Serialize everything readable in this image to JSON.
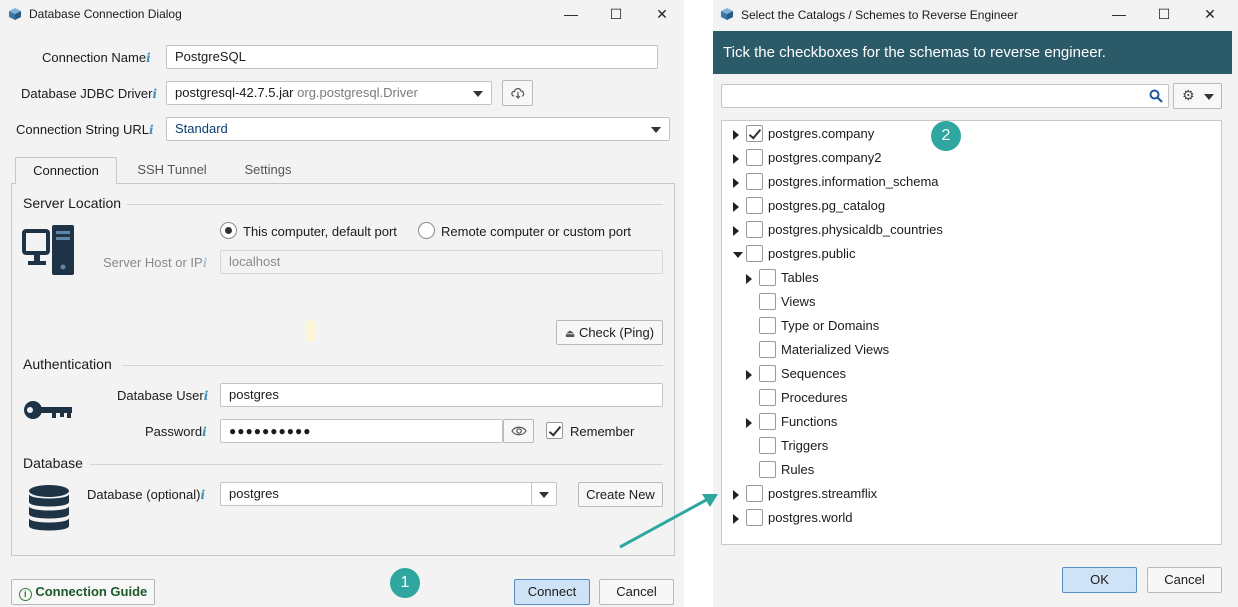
{
  "left_dialog": {
    "title": "Database Connection Dialog",
    "labels": {
      "connection_name": "Connection Name",
      "jdbc_driver": "Database JDBC Driver",
      "connection_url": "Connection String URL",
      "info": "i"
    },
    "connection_name": "PostgreSQL",
    "driver_jar": "postgresql-42.7.5.jar",
    "driver_class": "org.postgresql.Driver",
    "connection_url": "Standard",
    "tabs": [
      {
        "label": "Connection",
        "active": true
      },
      {
        "label": "SSH Tunnel",
        "active": false
      },
      {
        "label": "Settings",
        "active": false
      }
    ],
    "server_location": {
      "title": "Server Location",
      "radio_local": "This computer, default port",
      "radio_remote": "Remote computer or custom port",
      "selected": "local",
      "host_label": "Server Host or IP",
      "host_value": "localhost",
      "ping_button": "Check (Ping)"
    },
    "authentication": {
      "title": "Authentication",
      "user_label": "Database User",
      "user_value": "postgres",
      "password_label": "Password",
      "password_value": "●●●●●●●●●●",
      "remember_label": "Remember",
      "remember_checked": true
    },
    "database": {
      "title": "Database",
      "db_label": "Database (optional)",
      "db_value": "postgres",
      "create_button": "Create New"
    },
    "footer": {
      "guide_button": "Connection Guide",
      "connect_button": "Connect",
      "cancel_button": "Cancel"
    }
  },
  "right_dialog": {
    "title": "Select the Catalogs / Schemes to Reverse Engineer",
    "banner": "Tick the checkboxes for the schemas to reverse engineer.",
    "search_placeholder": "",
    "tree": [
      {
        "label": "postgres.company",
        "level": 0,
        "expander": "closed",
        "checked": true
      },
      {
        "label": "postgres.company2",
        "level": 0,
        "expander": "closed",
        "checked": false
      },
      {
        "label": "postgres.information_schema",
        "level": 0,
        "expander": "closed",
        "checked": false
      },
      {
        "label": "postgres.pg_catalog",
        "level": 0,
        "expander": "closed",
        "checked": false
      },
      {
        "label": "postgres.physicaldb_countries",
        "level": 0,
        "expander": "closed",
        "checked": false
      },
      {
        "label": "postgres.public",
        "level": 0,
        "expander": "open",
        "checked": false
      },
      {
        "label": "Tables",
        "level": 1,
        "expander": "closed",
        "checked": false
      },
      {
        "label": "Views",
        "level": 1,
        "expander": "none",
        "checked": false
      },
      {
        "label": "Type or Domains",
        "level": 1,
        "expander": "none",
        "checked": false
      },
      {
        "label": "Materialized Views",
        "level": 1,
        "expander": "none",
        "checked": false
      },
      {
        "label": "Sequences",
        "level": 1,
        "expander": "closed",
        "checked": false
      },
      {
        "label": "Procedures",
        "level": 1,
        "expander": "none",
        "checked": false
      },
      {
        "label": "Functions",
        "level": 1,
        "expander": "closed",
        "checked": false
      },
      {
        "label": "Triggers",
        "level": 1,
        "expander": "none",
        "checked": false
      },
      {
        "label": "Rules",
        "level": 1,
        "expander": "none",
        "checked": false
      },
      {
        "label": "postgres.streamflix",
        "level": 0,
        "expander": "closed",
        "checked": false
      },
      {
        "label": "postgres.world",
        "level": 0,
        "expander": "closed",
        "checked": false
      }
    ],
    "ok_button": "OK",
    "cancel_button": "Cancel"
  },
  "annotations": {
    "badge_1": "1",
    "badge_2": "2",
    "color": "#2fa7a0"
  },
  "colors": {
    "banner_bg": "#2b5a68",
    "primary_button_bg": "#cfe3f6",
    "accent": "#3c8fb8"
  }
}
